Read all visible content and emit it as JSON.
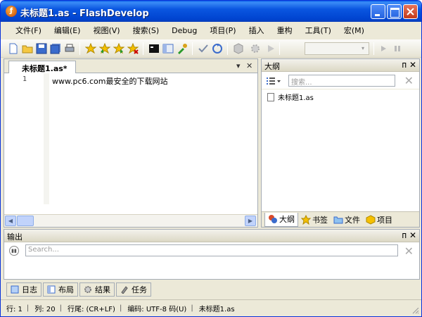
{
  "window": {
    "title": "未标题1.as - FlashDevelop"
  },
  "menu": [
    "文件(F)",
    "编辑(E)",
    "视图(V)",
    "搜索(S)",
    "Debug",
    "项目(P)",
    "插入",
    "重构",
    "工具(T)",
    "宏(M)"
  ],
  "toolbar": {
    "icons": [
      "new-file-icon",
      "open-icon",
      "save-icon",
      "save-all-icon",
      "print-icon",
      "bookmark-star-icon",
      "bookmark-prev-icon",
      "bookmark-next-icon",
      "bookmark-clear-icon",
      "console-icon",
      "panel-icon",
      "tools-icon",
      "check-icon",
      "refresh-icon",
      "build-icon",
      "settings-icon",
      "run-icon",
      "play-icon",
      "pause-icon"
    ],
    "config_combo": ""
  },
  "editor": {
    "tab_label": "未标题1.as*",
    "tab_menu": "▾",
    "tab_close": "✕",
    "line_number": "1",
    "code_line": "www.pc6.com最安全的下载网站"
  },
  "outline": {
    "header": "大纲",
    "pin": "ᴨ",
    "close": "✕",
    "search_placeholder": "搜索...",
    "tree_item": "未标题1.as",
    "tabs": [
      "大纲",
      "书签",
      "文件",
      "项目"
    ]
  },
  "output": {
    "header": "输出",
    "pin": "ᴨ",
    "close": "✕",
    "search_placeholder": "Search..."
  },
  "bottom_tabs": [
    "日志",
    "布局",
    "结果",
    "任务"
  ],
  "status": {
    "line": "行: 1",
    "col": "列: 20",
    "eol": "行尾: (CR+LF)",
    "encoding": "编码: UTF-8 码(U)",
    "file": "未标题1.as",
    "sep": "|"
  },
  "colors": {
    "title_bar": "#0054e3",
    "window_bg": "#ece9d8",
    "close_button": "#d4502d"
  }
}
